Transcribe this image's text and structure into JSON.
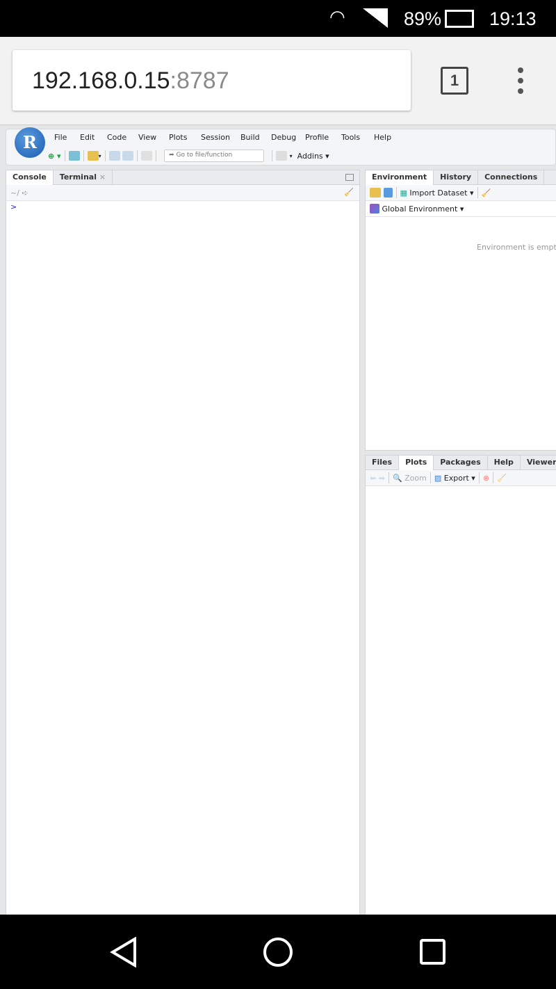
{
  "status_bar": {
    "battery": "89%",
    "time": "19:13"
  },
  "browser": {
    "url_host": "192.168.0.15",
    "url_port": ":8787",
    "tab_count": "1"
  },
  "menu": [
    "File",
    "Edit",
    "Code",
    "View",
    "Plots",
    "Session",
    "Build",
    "Debug",
    "Profile",
    "Tools",
    "Help"
  ],
  "toolbar": {
    "goto_placeholder": "Go to file/function",
    "addins": "Addins"
  },
  "logo": "R",
  "console_pane": {
    "tabs": [
      "Console",
      "Terminal"
    ],
    "path": "~/",
    "prompt": ">"
  },
  "env_pane": {
    "tabs": [
      "Environment",
      "History",
      "Connections"
    ],
    "import_dataset": "Import Dataset",
    "global_env": "Global Environment",
    "empty_msg": "Environment is empty"
  },
  "files_pane": {
    "tabs": [
      "Files",
      "Plots",
      "Packages",
      "Help",
      "Viewer"
    ],
    "zoom": "Zoom",
    "export": "Export"
  }
}
